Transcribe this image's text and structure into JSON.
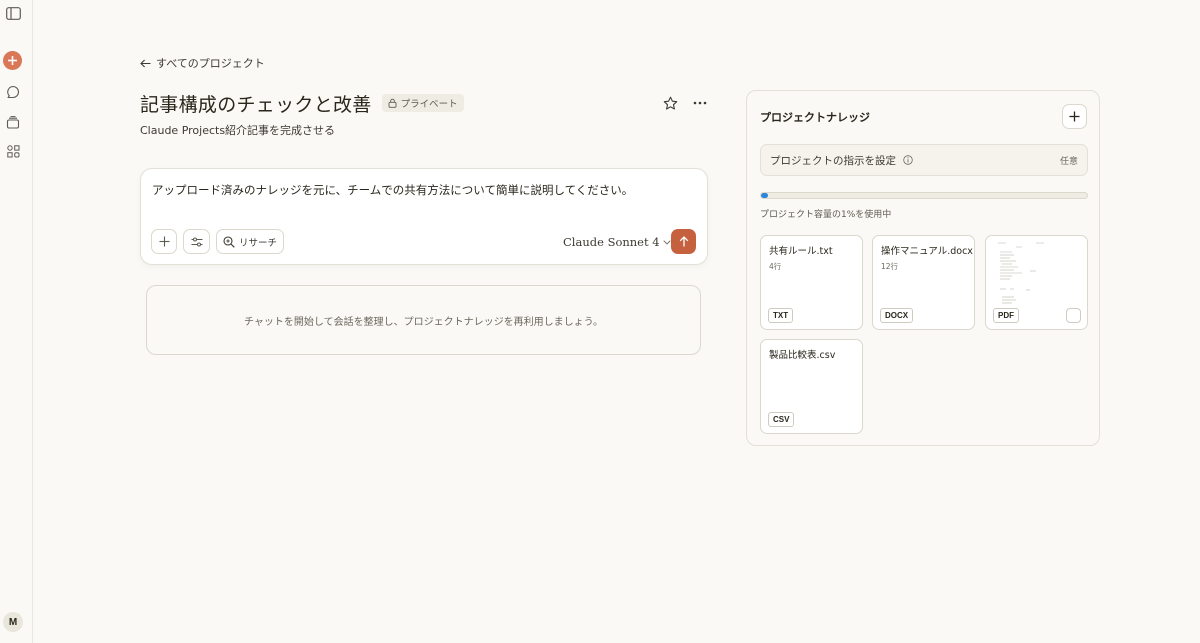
{
  "nav": {
    "back_label": "すべてのプロジェクト",
    "avatar_initial": "M"
  },
  "project": {
    "title": "記事構成のチェックと改善",
    "visibility": "プライベート",
    "description": "Claude Projects紹介記事を完成させる"
  },
  "composer": {
    "input_value": "アップロード済みのナレッジを元に、チームでの共有方法について簡単に説明してください。",
    "research_label": "リサーチ",
    "model": "Claude Sonnet 4"
  },
  "empty_state": {
    "message": "チャットを開始して会話を整理し、プロジェクトナレッジを再利用しましょう。"
  },
  "knowledge": {
    "title": "プロジェクトナレッジ",
    "instructions_label": "プロジェクトの指示を設定",
    "instructions_optional": "任意",
    "capacity_percent": 1,
    "capacity_text": "プロジェクト容量の1%を使用中",
    "files": [
      {
        "name": "共有ルール.txt",
        "lines": "4行",
        "type": "TXT"
      },
      {
        "name": "操作マニュアル.docx",
        "lines": "12行",
        "type": "DOCX"
      },
      {
        "name": "",
        "lines": "",
        "type": "PDF"
      },
      {
        "name": "製品比較表.csv",
        "lines": "",
        "type": "CSV"
      }
    ]
  },
  "colors": {
    "accent": "#c6613f",
    "new_chat": "#d97757",
    "capacity_fill": "#2c84db",
    "background": "#faf9f5"
  },
  "icons": {
    "sidebar_toggle": "sidebar-toggle-icon",
    "new_chat": "plus-circle-icon",
    "chats": "chat-bubble-icon",
    "projects": "folder-stack-icon",
    "artifacts": "grid-icon",
    "star": "star-icon",
    "more": "ellipsis-icon",
    "send": "arrow-up-icon"
  }
}
